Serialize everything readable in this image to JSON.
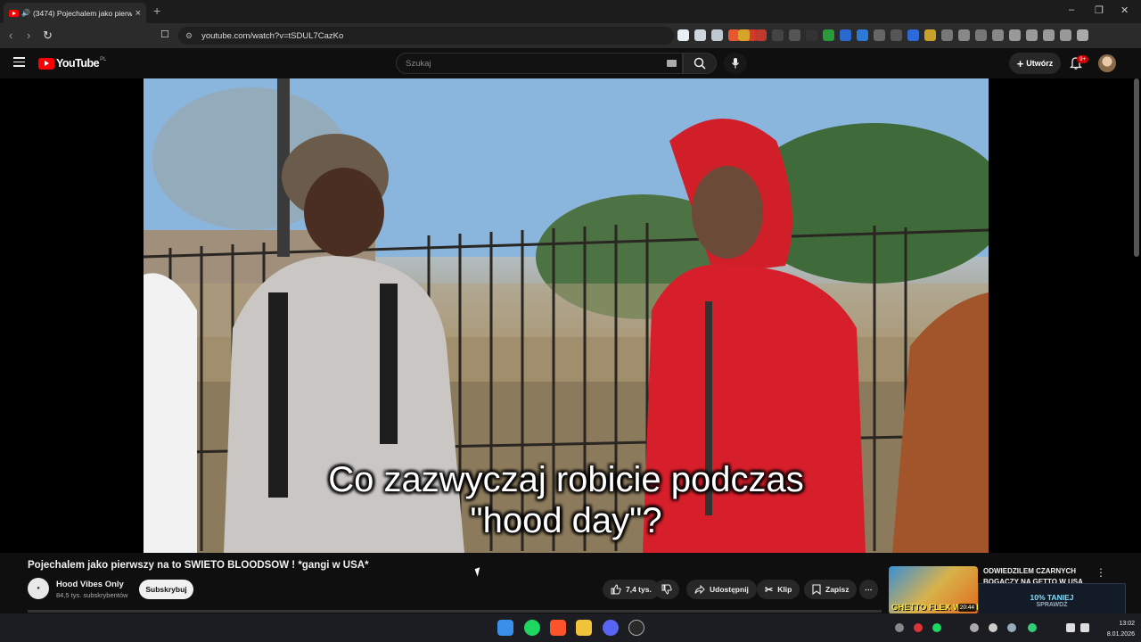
{
  "browser": {
    "tab_title": "(3474) Pojechalem jako pierws",
    "url": "youtube.com/watch?v=tSDUL7CazKo",
    "new_tab": "+",
    "window_controls": [
      "‒",
      "❐",
      "✕"
    ]
  },
  "youtube": {
    "logo_text": "YouTube",
    "region": "PL",
    "search_placeholder": "Szukaj",
    "create_label": "Utwórz",
    "notif_badge": "9+"
  },
  "video": {
    "subtitle_line1": "Co zazwyczaj robicie podczas",
    "subtitle_line2": "\"hood day\"?",
    "title": "Pojechalem jako pierwszy na to SWIETO BLOODSOW ! *gangi w USA*",
    "channel_name": "Hood Vibes Only",
    "subscribers": "84,5 tys. subskrybentów",
    "subscribe_label": "Subskrybuj",
    "likes": "7,4 tys.",
    "share_label": "Udostępnij",
    "clip_label": "Klip",
    "save_label": "Zapisz",
    "more_label": "⋯"
  },
  "recommendation": {
    "title": "ODWIEDZILEM CZARNYCH BOGACZY NA GETTO W USA",
    "thumb_text": "GHETTO FLEX W AME",
    "duration": "20:44"
  },
  "promo": {
    "line1": "10% TANIEJ",
    "line2": "SPRAWDŹ"
  },
  "taskbar": {
    "time": "13:02",
    "date": "8.01.2026"
  },
  "colors": {
    "youtube_red": "#ff0000",
    "background": "#0f0f0f",
    "pill": "#272727"
  }
}
